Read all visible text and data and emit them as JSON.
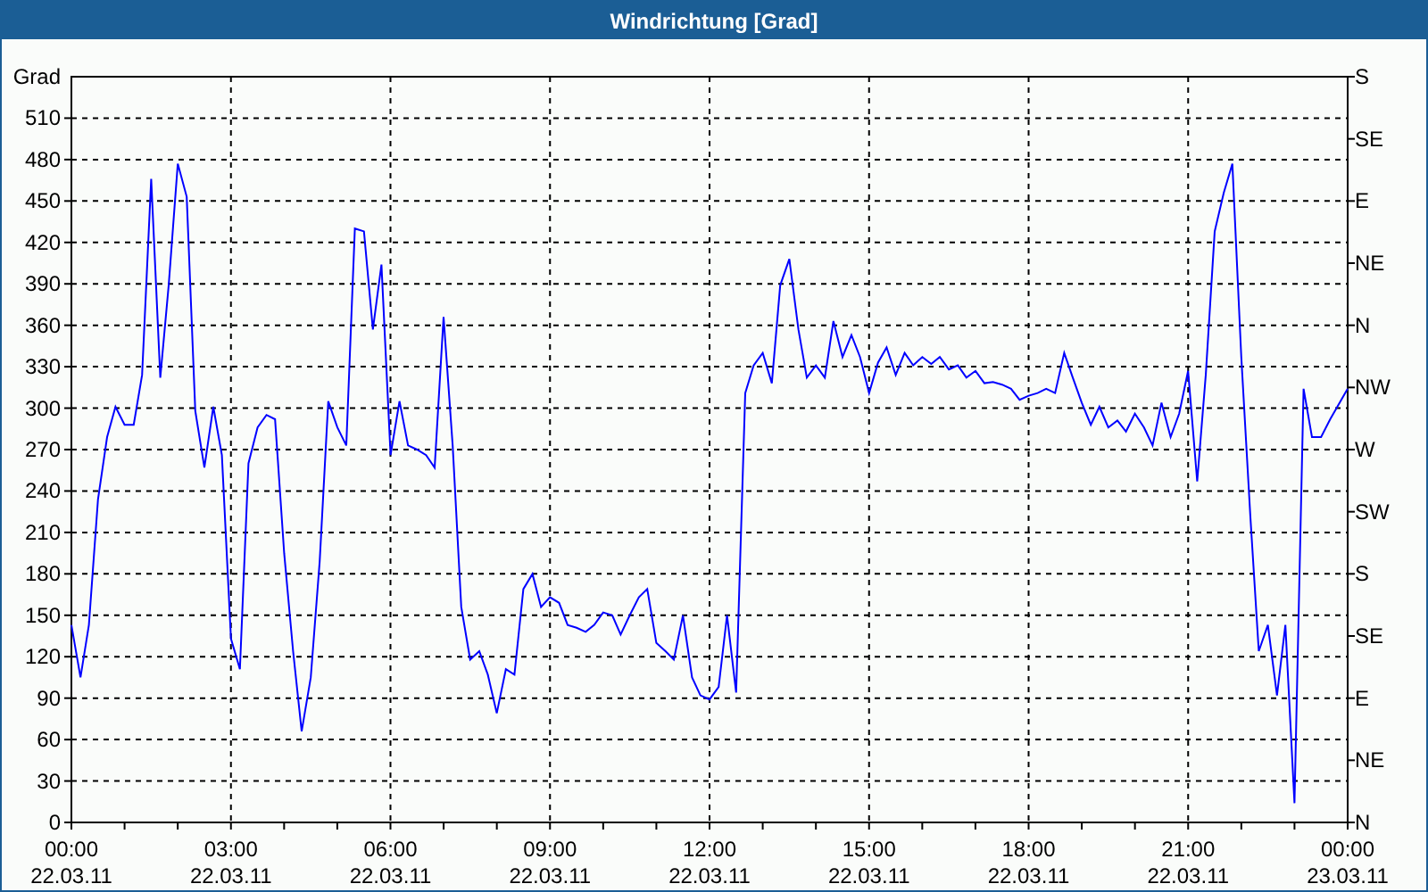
{
  "window": {
    "title": "Windrichtung [Grad]"
  },
  "chart": {
    "chart_data": {
      "type": "line",
      "grid": true,
      "ylabel": "Grad",
      "xlim": [
        0,
        24
      ],
      "ylim": [
        0,
        540
      ],
      "yticks": [
        0,
        30,
        60,
        90,
        120,
        150,
        180,
        210,
        240,
        270,
        300,
        330,
        360,
        390,
        420,
        450,
        480,
        510
      ],
      "xticks": [
        {
          "value": 0,
          "label": "00:00"
        },
        {
          "value": 3,
          "label": "03:00"
        },
        {
          "value": 6,
          "label": "06:00"
        },
        {
          "value": 9,
          "label": "09:00"
        },
        {
          "value": 12,
          "label": "12:00"
        },
        {
          "value": 15,
          "label": "15:00"
        },
        {
          "value": 18,
          "label": "18:00"
        },
        {
          "value": 21,
          "label": "21:00"
        },
        {
          "value": 24,
          "label": "00:00"
        }
      ],
      "x": [
        0,
        0.17,
        0.33,
        0.5,
        0.67,
        0.83,
        1,
        1.17,
        1.33,
        1.5,
        1.67,
        1.83,
        2,
        2.17,
        2.33,
        2.5,
        2.67,
        2.83,
        3,
        3.17,
        3.33,
        3.5,
        3.67,
        3.83,
        4,
        4.17,
        4.33,
        4.5,
        4.67,
        4.83,
        5,
        5.17,
        5.33,
        5.5,
        5.67,
        5.83,
        6,
        6.17,
        6.33,
        6.5,
        6.67,
        6.83,
        7,
        7.17,
        7.33,
        7.5,
        7.67,
        7.83,
        8,
        8.17,
        8.33,
        8.5,
        8.67,
        8.83,
        9,
        9.17,
        9.33,
        9.5,
        9.67,
        9.83,
        10,
        10.17,
        10.33,
        10.5,
        10.67,
        10.83,
        11,
        11.17,
        11.33,
        11.5,
        11.67,
        11.83,
        12,
        12.17,
        12.33,
        12.5,
        12.67,
        12.83,
        13,
        13.17,
        13.33,
        13.5,
        13.67,
        13.83,
        14,
        14.17,
        14.33,
        14.5,
        14.67,
        14.83,
        15,
        15.17,
        15.33,
        15.5,
        15.67,
        15.83,
        16,
        16.17,
        16.33,
        16.5,
        16.67,
        16.83,
        17,
        17.17,
        17.33,
        17.5,
        17.67,
        17.83,
        18,
        18.17,
        18.33,
        18.5,
        18.67,
        18.83,
        19,
        19.17,
        19.33,
        19.5,
        19.67,
        19.83,
        20,
        20.17,
        20.33,
        20.5,
        20.67,
        20.83,
        21,
        21.17,
        21.33,
        21.5,
        21.67,
        21.83,
        22,
        22.17,
        22.33,
        22.5,
        22.67,
        22.83,
        23,
        23.17,
        23.33,
        23.5,
        23.67,
        24
      ],
      "series": [
        {
          "color": "#0000ff",
          "values": [
            143,
            105,
            143,
            234,
            279,
            301,
            288,
            288,
            324,
            466,
            322,
            389,
            477,
            453,
            298,
            257,
            301,
            266,
            133,
            111,
            260,
            286,
            295,
            292,
            195,
            124,
            66,
            105,
            189,
            305,
            286,
            273,
            430,
            428,
            357,
            404,
            266,
            305,
            273,
            270,
            266,
            257,
            366,
            273,
            156,
            118,
            124,
            107,
            79,
            111,
            107,
            169,
            180,
            156,
            163,
            159,
            143,
            141,
            138,
            143,
            152,
            150,
            136,
            150,
            163,
            169,
            130,
            124,
            118,
            150,
            105,
            92,
            89,
            98,
            150,
            94,
            311,
            331,
            340,
            318,
            389,
            408,
            357,
            322,
            331,
            322,
            363,
            337,
            353,
            337,
            311,
            333,
            344,
            324,
            340,
            331,
            337,
            332,
            337,
            328,
            331,
            322,
            327,
            318,
            319,
            317,
            314,
            306,
            309,
            311,
            314,
            311,
            340,
            322,
            304,
            288,
            301,
            286,
            291,
            283,
            296,
            286,
            273,
            304,
            279,
            296,
            327,
            247,
            324,
            428,
            456,
            477,
            337,
            221,
            124,
            143,
            92,
            143,
            14,
            314,
            279,
            279,
            292,
            314
          ]
        }
      ]
    },
    "x_dates": [
      "22.03.11",
      "22.03.11",
      "22.03.11",
      "22.03.11",
      "22.03.11",
      "22.03.11",
      "22.03.11",
      "22.03.11",
      "23.03.11"
    ],
    "right_axis": {
      "ticks": [
        "S",
        "SE",
        "E",
        "NE",
        "N",
        "NW",
        "W",
        "SW",
        "S",
        "SE",
        "E",
        "NE",
        "N"
      ]
    }
  }
}
